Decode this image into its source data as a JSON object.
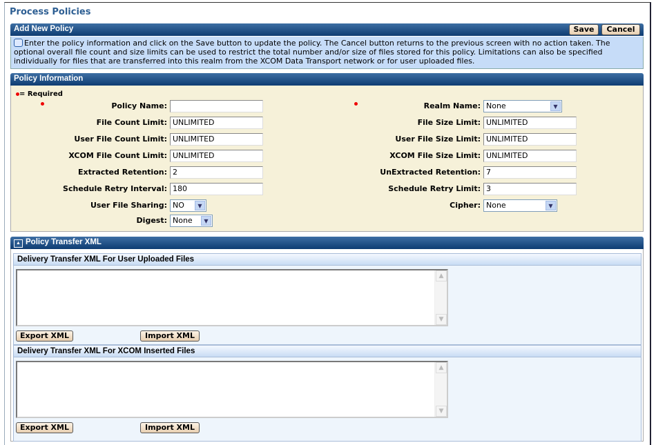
{
  "page_title": "Process Policies",
  "add_policy": {
    "title": "Add New Policy",
    "save": "Save",
    "cancel": "Cancel",
    "info_text": "Enter the policy information and click on the Save button to update the policy. The Cancel button returns to the previous screen with no action taken. The optional overall file count and size limits can be used to restrict the total number and/or size of files stored for this policy. Limitations can also be specified individually for files that are transferred into this realm from the XCOM Data Transport network or for user uploaded files."
  },
  "policy_info": {
    "title": "Policy Information",
    "required": "= Required",
    "left": [
      {
        "label": "Policy Name:",
        "value": ""
      },
      {
        "label": "File Count Limit:",
        "value": "UNLIMITED"
      },
      {
        "label": "User File Count Limit:",
        "value": "UNLIMITED"
      },
      {
        "label": "XCOM File Count Limit:",
        "value": "UNLIMITED"
      },
      {
        "label": "Extracted Retention:",
        "value": "2"
      },
      {
        "label": "Schedule Retry Interval:",
        "value": "180"
      },
      {
        "label": "User File Sharing:",
        "value": "NO"
      },
      {
        "label": "Digest:",
        "value": "None"
      }
    ],
    "right": [
      {
        "label": "Realm Name:",
        "value": "None"
      },
      {
        "label": "File Size Limit:",
        "value": "UNLIMITED"
      },
      {
        "label": "User File Size Limit:",
        "value": "UNLIMITED"
      },
      {
        "label": "XCOM File Size Limit:",
        "value": "UNLIMITED"
      },
      {
        "label": "UnExtracted Retention:",
        "value": "7"
      },
      {
        "label": "Schedule Retry Limit:",
        "value": "3"
      },
      {
        "label": "Cipher:",
        "value": "None"
      }
    ]
  },
  "xml": {
    "title": "Policy Transfer XML",
    "sections": [
      {
        "title": "Delivery Transfer XML For User Uploaded Files",
        "export": "Export XML",
        "import": "Import XML",
        "content": ""
      },
      {
        "title": "Delivery Transfer XML For XCOM Inserted Files",
        "export": "Export XML",
        "import": "Import XML",
        "content": ""
      }
    ]
  }
}
